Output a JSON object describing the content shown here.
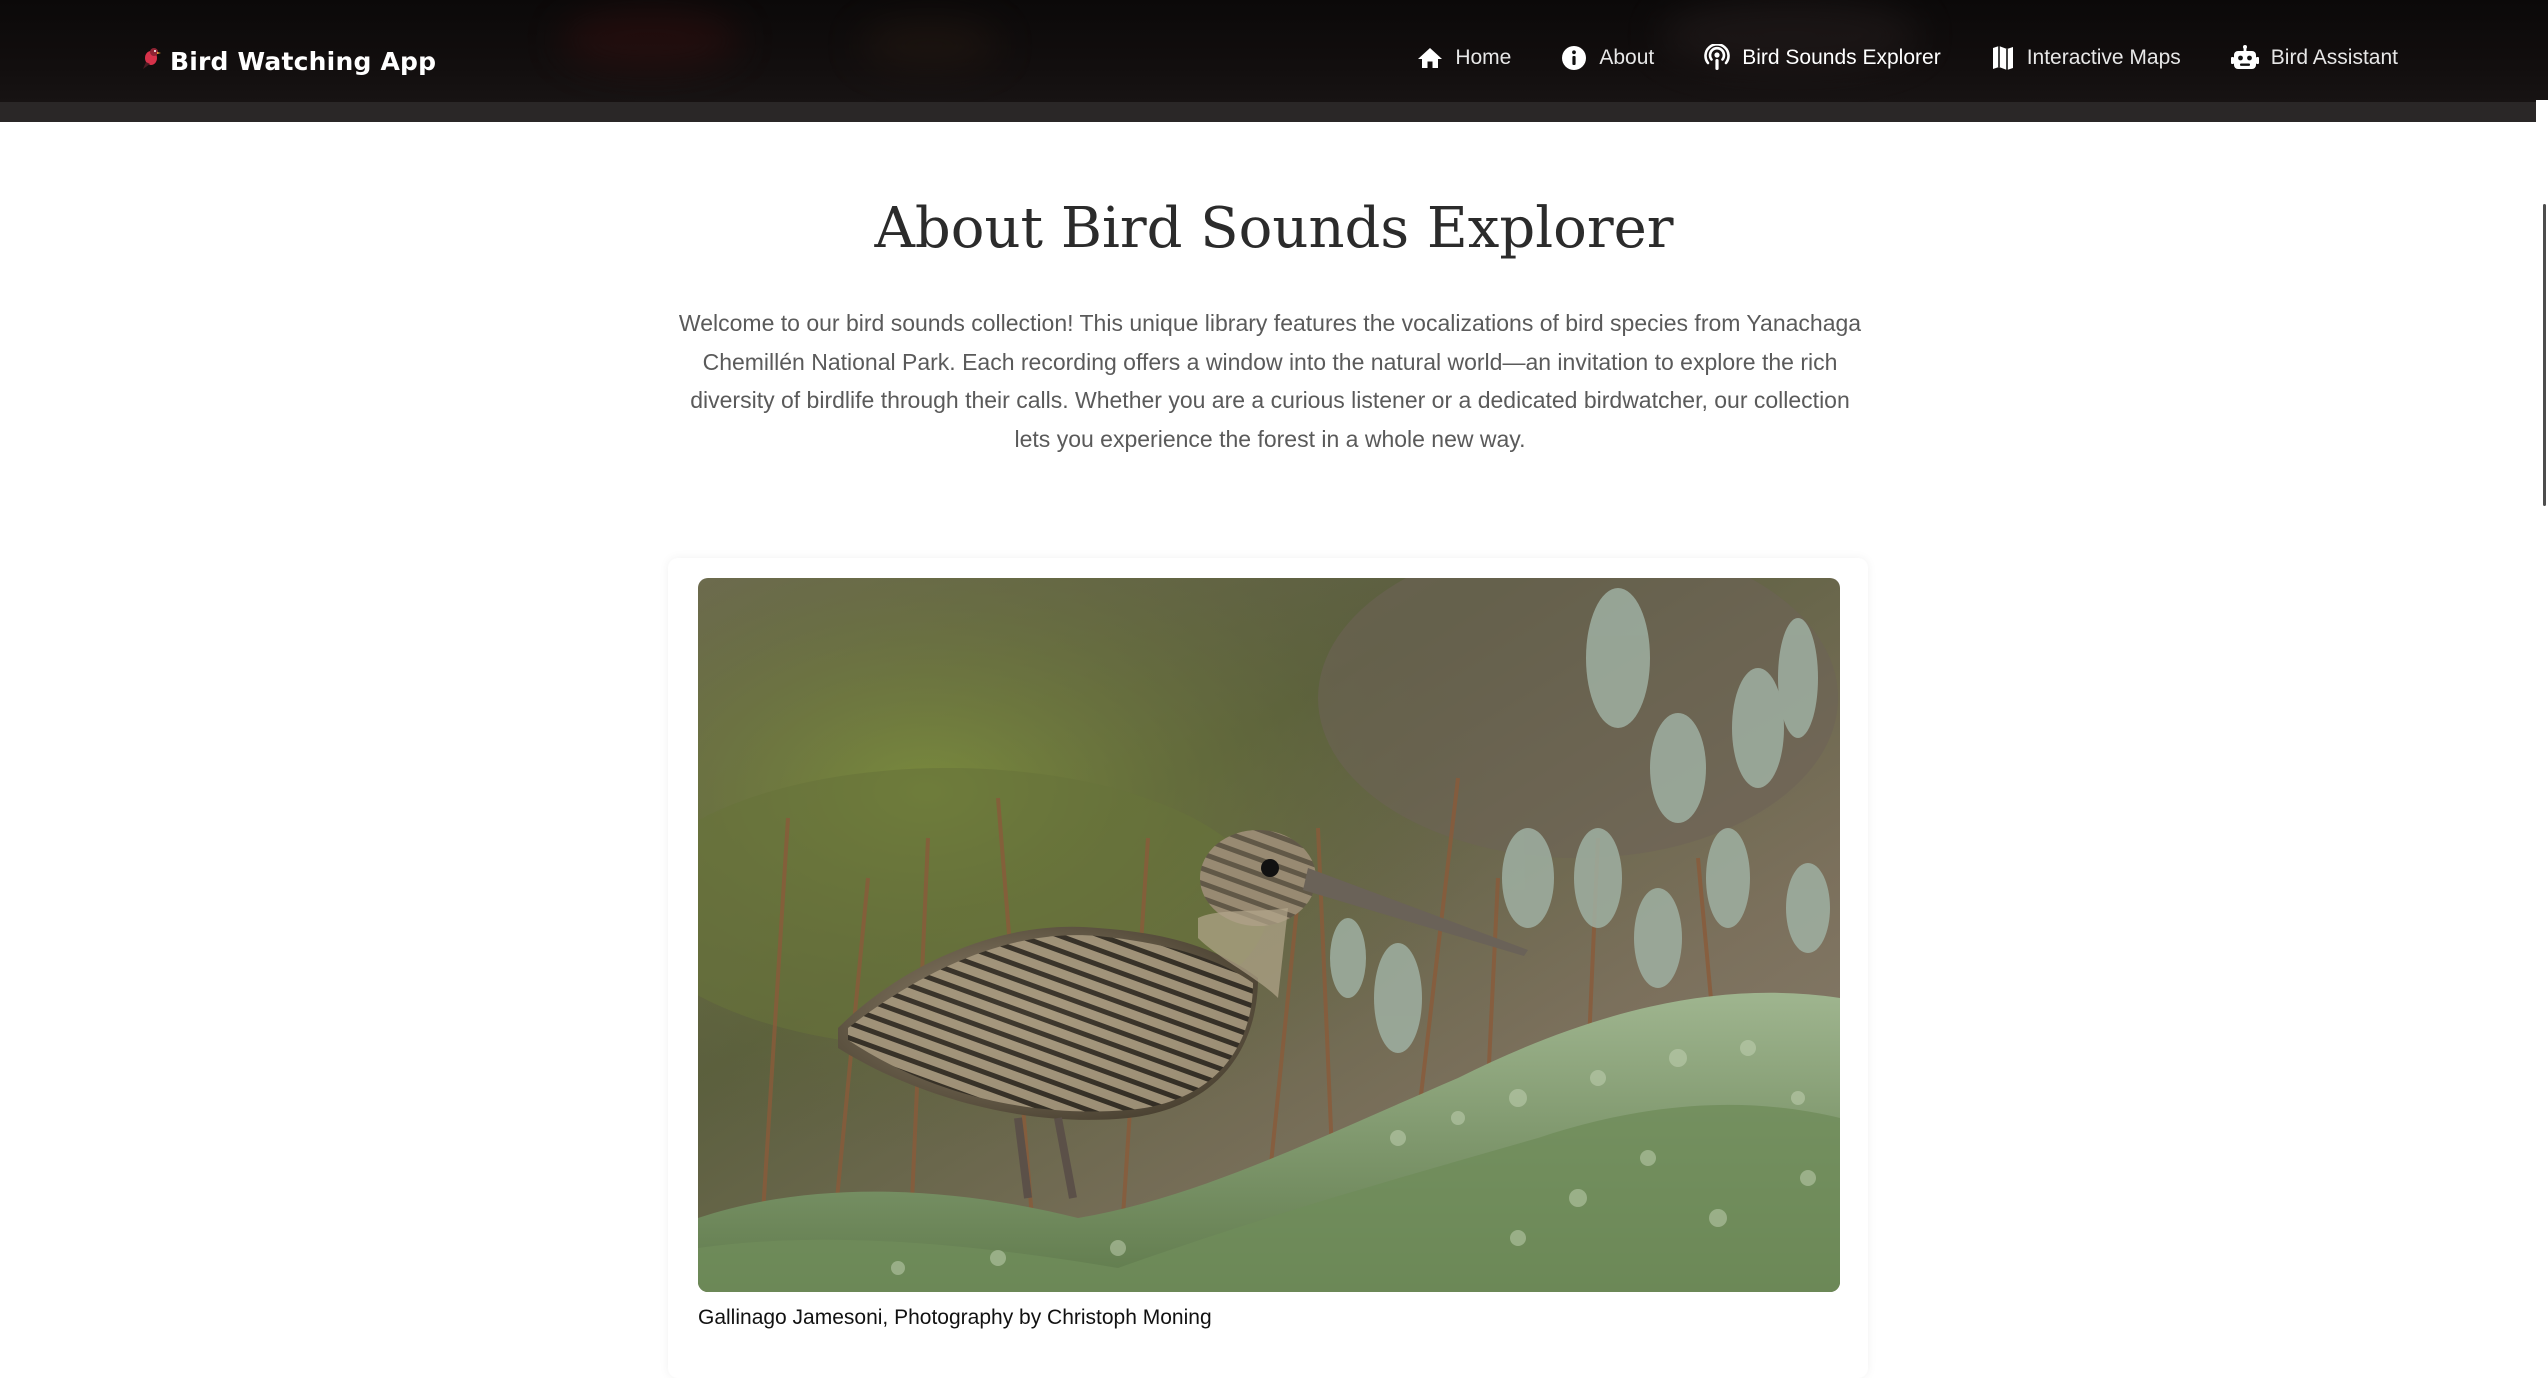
{
  "navbar": {
    "brand": "Bird Watching App",
    "brand_icon": "bird-icon",
    "links": [
      {
        "label": "Home",
        "icon": "home-icon",
        "active": false
      },
      {
        "label": "About",
        "icon": "info-icon",
        "active": false
      },
      {
        "label": "Bird Sounds Explorer",
        "icon": "podcast-icon",
        "active": true
      },
      {
        "label": "Interactive Maps",
        "icon": "map-icon",
        "active": false
      },
      {
        "label": "Bird Assistant",
        "icon": "robot-icon",
        "active": false
      }
    ]
  },
  "page": {
    "title": "About Bird Sounds Explorer",
    "intro": "Welcome to our bird sounds collection! This unique library features the vocalizations of bird species from Yanachaga Chemillén National Park. Each recording offers a window into the natural world—an invitation to explore the rich diversity of birdlife through their calls. Whether you are a curious listener or a dedicated birdwatcher, our collection lets you experience the forest in a whole new way."
  },
  "featured": {
    "caption": "Gallinago Jamesoni, Photography by Christoph Moning"
  },
  "colors": {
    "navbar_bg": "#0b0909",
    "title_text": "#2b2b2b",
    "body_text": "#5a5a5a"
  }
}
